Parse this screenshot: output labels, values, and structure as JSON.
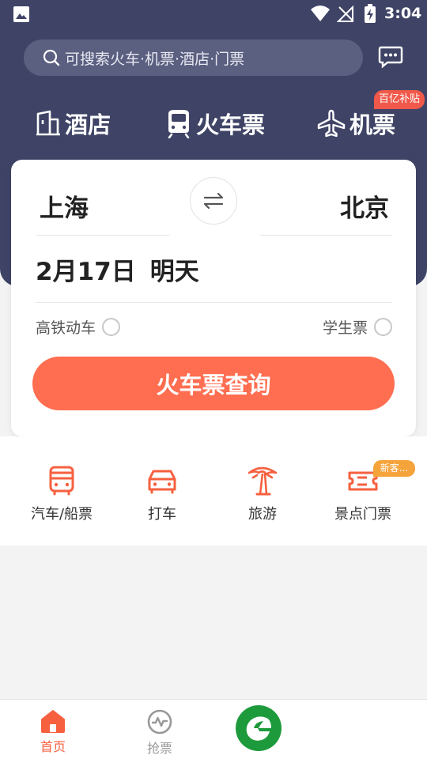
{
  "status_bar": {
    "time": "3:04"
  },
  "search": {
    "placeholder": "可搜索火车·机票·酒店·门票"
  },
  "tabs": [
    {
      "label": "酒店",
      "icon": "hotel-icon"
    },
    {
      "label": "火车票",
      "icon": "train-icon",
      "active": true
    },
    {
      "label": "机票",
      "icon": "airplane-icon",
      "badge": "百亿补贴"
    }
  ],
  "booking": {
    "from_city": "上海",
    "to_city": "北京",
    "date": "2月17日",
    "date_note": "明天",
    "options": {
      "high_speed": "高铁动车",
      "student": "学生票"
    },
    "search_button": "火车票查询"
  },
  "quick_links": [
    {
      "label": "汽车/船票",
      "icon": "bus-icon"
    },
    {
      "label": "打车",
      "icon": "car-icon"
    },
    {
      "label": "旅游",
      "icon": "palm-tree-icon"
    },
    {
      "label": "景点门票",
      "icon": "ticket-icon",
      "badge": "新客..."
    }
  ],
  "bottom_nav": [
    {
      "label": "首页",
      "icon": "home-icon",
      "active": true
    },
    {
      "label": "抢票",
      "icon": "grab-ticket-icon"
    }
  ],
  "colors": {
    "header": "#3f4466",
    "accent": "#ff6e51",
    "badge_red": "#f0584a",
    "badge_orange": "#f5a33b",
    "logo_green": "#1d9a3b"
  }
}
